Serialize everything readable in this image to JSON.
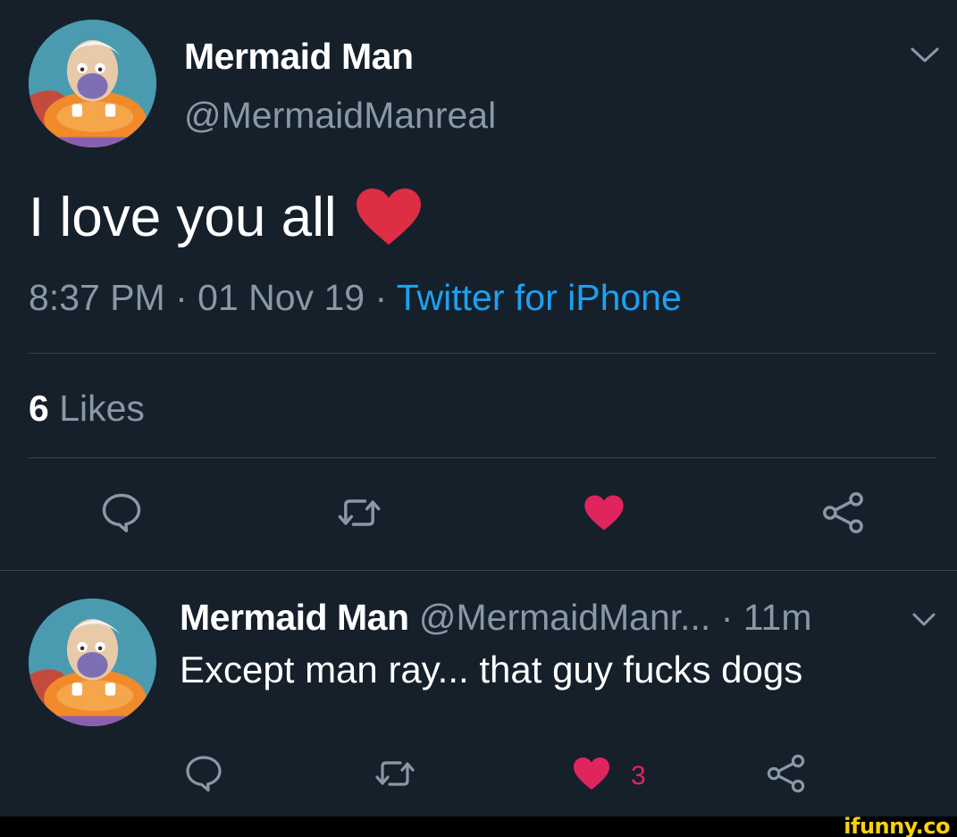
{
  "tweet": {
    "author_name": "Mermaid Man",
    "author_handle": "@MermaidManreal",
    "text": "I love you all",
    "text_emoji": "red-heart-emoji",
    "time": "8:37 PM",
    "date": "01 Nov 19",
    "separator": " · ",
    "source": "Twitter for iPhone",
    "likes_count": "6",
    "likes_label": "Likes",
    "liked": true
  },
  "reply": {
    "author_name": "Mermaid Man",
    "author_handle": "@MermaidManr...",
    "age": "· 11m",
    "text": "Except man ray... that guy fucks dogs",
    "like_count": "3",
    "liked": true
  },
  "icons": {
    "reply": "reply-icon",
    "retweet": "retweet-icon",
    "like": "heart-icon",
    "share": "share-icon",
    "more": "chevron-down-icon"
  },
  "colors": {
    "background": "#15202b",
    "secondary_text": "#8899a6",
    "link": "#1da1f2",
    "like": "#e0245e",
    "divider": "#38444d"
  },
  "watermark": "ifunny.co"
}
